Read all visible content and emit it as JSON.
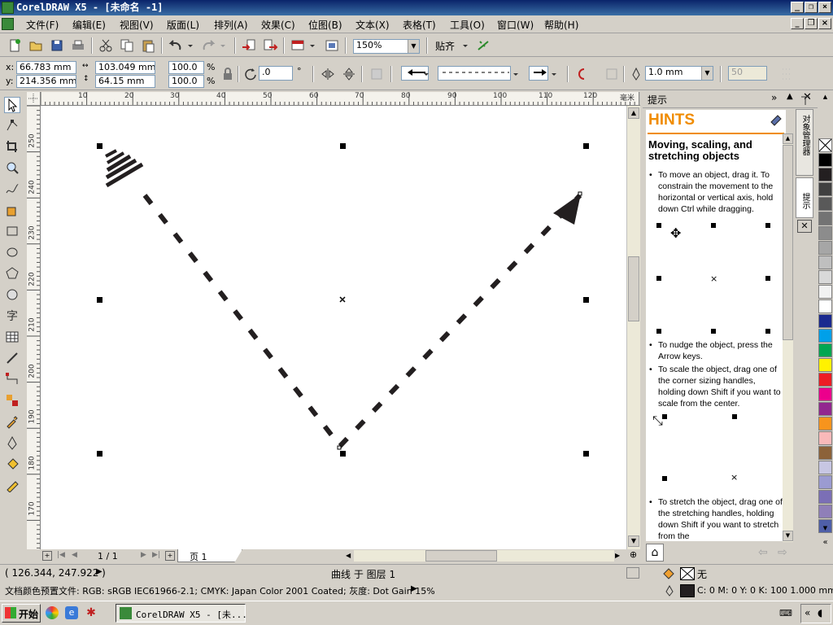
{
  "window": {
    "title": "CorelDRAW X5 - [未命名 -1]"
  },
  "menu": [
    "文件(F)",
    "编辑(E)",
    "视图(V)",
    "版面(L)",
    "排列(A)",
    "效果(C)",
    "位图(B)",
    "文本(X)",
    "表格(T)",
    "工具(O)",
    "窗口(W)",
    "帮助(H)"
  ],
  "toolbar": {
    "zoom": "150%",
    "snap_label": "贴齐"
  },
  "property_bar": {
    "x_label": "x:",
    "x_value": "66.783 mm",
    "y_label": "y:",
    "y_value": "214.356 mm",
    "width_value": "103.049 mm",
    "height_value": "64.15 mm",
    "scale_x": "100.0",
    "scale_y": "100.0",
    "percent": "%",
    "rotation": ".0",
    "degree": "°",
    "outline_width": "1.0 mm",
    "miter": "50"
  },
  "ruler": {
    "top_ticks": [
      "10",
      "20",
      "30",
      "40",
      "50",
      "60",
      "70",
      "80",
      "90",
      "100",
      "110",
      "120"
    ],
    "top_unit": "毫米",
    "left_ticks": [
      "250",
      "240",
      "230",
      "220",
      "210",
      "200",
      "190",
      "180",
      "170"
    ]
  },
  "page_nav": {
    "counter": "1 / 1",
    "page_tab": "页 1"
  },
  "docker": {
    "title": "提示",
    "hints_title": "HINTS",
    "heading": "Moving, scaling, and stretching objects",
    "paragraphs": [
      "To move an object, drag it. To constrain the movement to the horizontal or vertical axis, hold down Ctrl while dragging.",
      "To nudge the object, press the Arrow keys.",
      "To scale the object, drag one of the corner sizing handles, holding down Shift if you want to scale from the center.",
      "To stretch the object, drag one of the stretching handles, holding down Shift if you want to stretch from the"
    ],
    "side_tabs": [
      "对象管理器",
      "提示"
    ]
  },
  "palette_colors": [
    "#000000",
    "#231f20",
    "#404040",
    "#595959",
    "#737373",
    "#8c8c8c",
    "#a6a6a6",
    "#bfbfbf",
    "#d9d9d9",
    "#f2f2f2",
    "#ffffff",
    "#1b2a8f",
    "#00a0e9",
    "#00a651",
    "#fff200",
    "#ed1c24",
    "#ec008c",
    "#92278f",
    "#f7941d",
    "#f9b9b9",
    "#8c6239",
    "#c7c6e3",
    "#9b9bd1",
    "#7b6fb6",
    "#8f7fb8",
    "#4f5fa8"
  ],
  "status": {
    "coords": "( 126.344, 247.922 )",
    "object_info": "曲线 于 图层 1",
    "color_profile": "文档颜色预置文件: RGB: sRGB IEC61966-2.1; CMYK: Japan Color 2001 Coated; 灰度: Dot Gain 15%",
    "fill_label": "无",
    "outline_info": "C: 0 M: 0 Y: 0 K: 100  1.000 mm"
  },
  "taskbar": {
    "start": "开始",
    "task": "CorelDRAW X5 - [未..."
  }
}
